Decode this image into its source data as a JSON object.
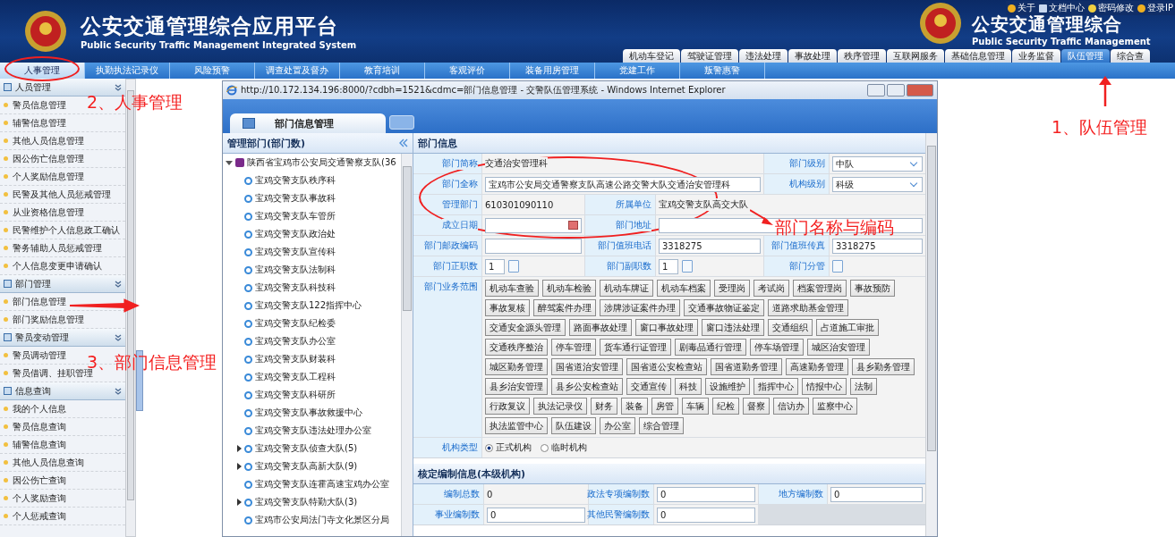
{
  "header": {
    "title": "公安交通管理综合应用平台",
    "subtitle": "Public Security Traffic Management Integrated System",
    "right_title": "公安交通管理综合",
    "right_subtitle": "Public Security Traffic Management",
    "links": [
      {
        "label": "关于",
        "kind": "info"
      },
      {
        "label": "文档中心",
        "kind": "doc"
      },
      {
        "label": "密码修改",
        "kind": "key"
      },
      {
        "label": "登录IP",
        "kind": "info"
      }
    ],
    "module_tabs": [
      {
        "label": "机动车登记",
        "selected": false
      },
      {
        "label": "驾驶证管理",
        "selected": false
      },
      {
        "label": "违法处理",
        "selected": false
      },
      {
        "label": "事故处理",
        "selected": false
      },
      {
        "label": "秩序管理",
        "selected": false
      },
      {
        "label": "互联网服务",
        "selected": false
      },
      {
        "label": "基础信息管理",
        "selected": false
      },
      {
        "label": "业务监督",
        "selected": false
      },
      {
        "label": "队伍管理",
        "selected": true
      },
      {
        "label": "综合查",
        "selected": false
      }
    ]
  },
  "nav_tabs": [
    {
      "label": "人事管理",
      "selected": true
    },
    {
      "label": "执勤执法记录仪",
      "selected": false
    },
    {
      "label": "风险预警",
      "selected": false
    },
    {
      "label": "调查处置及督办",
      "selected": false
    },
    {
      "label": "教育培训",
      "selected": false
    },
    {
      "label": "客观评价",
      "selected": false
    },
    {
      "label": "装备用房管理",
      "selected": false
    },
    {
      "label": "党建工作",
      "selected": false
    },
    {
      "label": "叛警惠警",
      "selected": false
    }
  ],
  "sidebar": {
    "groups": [
      {
        "title": "人员管理",
        "items": [
          "警员信息管理",
          "辅警信息管理",
          "其他人员信息管理",
          "因公伤亡信息管理",
          "个人奖励信息管理",
          "民警及其他人员惩戒管理",
          "从业资格信息管理",
          "民警维护个人信息政工确认",
          "警务辅助人员惩戒管理",
          "个人信息变更申请确认"
        ]
      },
      {
        "title": "部门管理",
        "items": [
          "部门信息管理",
          "部门奖励信息管理"
        ]
      },
      {
        "title": "警员变动管理",
        "items": [
          "警员调动管理",
          "警员借调、挂职管理"
        ]
      },
      {
        "title": "信息查询",
        "items": [
          "我的个人信息",
          "警员信息查询",
          "辅警信息查询",
          "其他人员信息查询",
          "因公伤亡查询",
          "个人奖励查询",
          "个人惩戒查询"
        ]
      }
    ]
  },
  "browser_window": {
    "title": "http://10.172.134.196:8000/?cdbh=1521&cdmc=部门信息管理 - 交警队伍管理系统 - Windows Internet Explorer",
    "tab": "部门信息管理"
  },
  "tree": {
    "title": "管理部门(部门数)",
    "root": {
      "label": "陕西省宝鸡市公安局交通警察支队(36",
      "expanded": true,
      "children": [
        {
          "label": "宝鸡交警支队秩序科",
          "kind": "leaf"
        },
        {
          "label": "宝鸡交警支队事故科",
          "kind": "leaf"
        },
        {
          "label": "宝鸡交警支队车管所",
          "kind": "leaf"
        },
        {
          "label": "宝鸡交警支队政治处",
          "kind": "leaf"
        },
        {
          "label": "宝鸡交警支队宣传科",
          "kind": "leaf"
        },
        {
          "label": "宝鸡交警支队法制科",
          "kind": "leaf"
        },
        {
          "label": "宝鸡交警支队科技科",
          "kind": "leaf"
        },
        {
          "label": "宝鸡交警支队122指挥中心",
          "kind": "leaf"
        },
        {
          "label": "宝鸡交警支队纪检委",
          "kind": "leaf"
        },
        {
          "label": "宝鸡交警支队办公室",
          "kind": "leaf"
        },
        {
          "label": "宝鸡交警支队财装科",
          "kind": "leaf"
        },
        {
          "label": "宝鸡交警支队工程科",
          "kind": "leaf"
        },
        {
          "label": "宝鸡交警支队科研所",
          "kind": "leaf"
        },
        {
          "label": "宝鸡交警支队事故救援中心",
          "kind": "leaf"
        },
        {
          "label": "宝鸡交警支队违法处理办公室",
          "kind": "leaf"
        },
        {
          "label": "宝鸡交警支队侦查大队(5)",
          "kind": "branch",
          "expanded": false
        },
        {
          "label": "宝鸡交警支队高新大队(9)",
          "kind": "branch",
          "expanded": false
        },
        {
          "label": "宝鸡交警支队连霍高速宝鸡办公室",
          "kind": "leaf"
        },
        {
          "label": "宝鸡交警支队特勤大队(3)",
          "kind": "branch",
          "expanded": false
        },
        {
          "label": "宝鸡市公安局法门寺文化景区分局",
          "kind": "leaf"
        }
      ]
    }
  },
  "form": {
    "title": "部门信息",
    "fields": [
      {
        "label": "部门简称",
        "kind": "text_wide",
        "value": "交通治安管理科"
      },
      {
        "label": "部门级别",
        "kind": "select",
        "value": "中队"
      },
      {
        "label": "部门全称",
        "kind": "input_wide",
        "value": "宝鸡市公安局交通警察支队高速公路交警大队交通治安管理科"
      },
      {
        "label": "机构级别",
        "kind": "select",
        "value": "科级"
      },
      {
        "label": "管理部门",
        "kind": "text",
        "value": "610301090110"
      },
      {
        "label": "所属单位",
        "kind": "text_wide",
        "value": "宝鸡交警支队高交大队"
      },
      {
        "label": "成立日期",
        "kind": "date"
      },
      {
        "label": "部门地址",
        "kind": "input_wide"
      },
      {
        "label": "部门邮政编码",
        "kind": "input"
      },
      {
        "label": "部门值班电话",
        "kind": "input",
        "value": "3318275"
      },
      {
        "label": "部门值班传真",
        "kind": "input",
        "value": "3318275"
      },
      {
        "label": "部门正职数",
        "kind": "count",
        "value": "1"
      },
      {
        "label": "部门副职数",
        "kind": "count",
        "value": "1"
      },
      {
        "label": "部门分管",
        "kind": "count"
      }
    ],
    "scope_label": "部门业务范围",
    "scope": [
      "机动车查验",
      "机动车检验",
      "机动车牌证",
      "机动车档案",
      "受理岗",
      "考试岗",
      "档案管理岗",
      "事故预防",
      "事故复核",
      "醉驾案件办理",
      "涉牌涉证案件办理",
      "交通事故物证鉴定",
      "道路求助基金管理",
      "交通安全源头管理",
      "路面事故处理",
      "窗口事故处理",
      "窗口违法处理",
      "交通组织",
      "占道施工审批",
      "交通秩序整治",
      "停车管理",
      "货车通行证管理",
      "剧毒品通行管理",
      "停车场管理",
      "城区治安管理",
      "城区勤务管理",
      "国省道治安管理",
      "国省道公安检查站",
      "国省道勤务管理",
      "高速勤务管理",
      "县乡勤务管理",
      "县乡治安管理",
      "县乡公安检查站",
      "交通宣传",
      "科技",
      "设施维护",
      "指挥中心",
      "情报中心",
      "法制",
      "行政复议",
      "执法记录仪",
      "财务",
      "装备",
      "房管",
      "车辆",
      "纪检",
      "督察",
      "信访办",
      "监察中心",
      "执法监管中心",
      "队伍建设",
      "办公室",
      "综合管理"
    ],
    "type_label": "机构类型",
    "type_options": [
      {
        "label": "正式机构",
        "selected": true
      },
      {
        "label": "临时机构",
        "selected": false
      }
    ]
  },
  "staffing": {
    "title": "核定编制信息(本级机构)",
    "fields": [
      {
        "label": "编制总数",
        "kind": "text",
        "value": "0"
      },
      {
        "label": "政法专项编制数",
        "kind": "input",
        "value": "0"
      },
      {
        "label": "地方编制数",
        "kind": "input",
        "value": "0"
      },
      {
        "label": "事业编制数",
        "kind": "input",
        "value": "0"
      },
      {
        "label": "其他民警编制数",
        "kind": "input",
        "value": "0"
      }
    ]
  },
  "annotations": [
    "1、队伍管理",
    "2、人事管理",
    "3、部门信息管理",
    "部门名称与编码"
  ]
}
